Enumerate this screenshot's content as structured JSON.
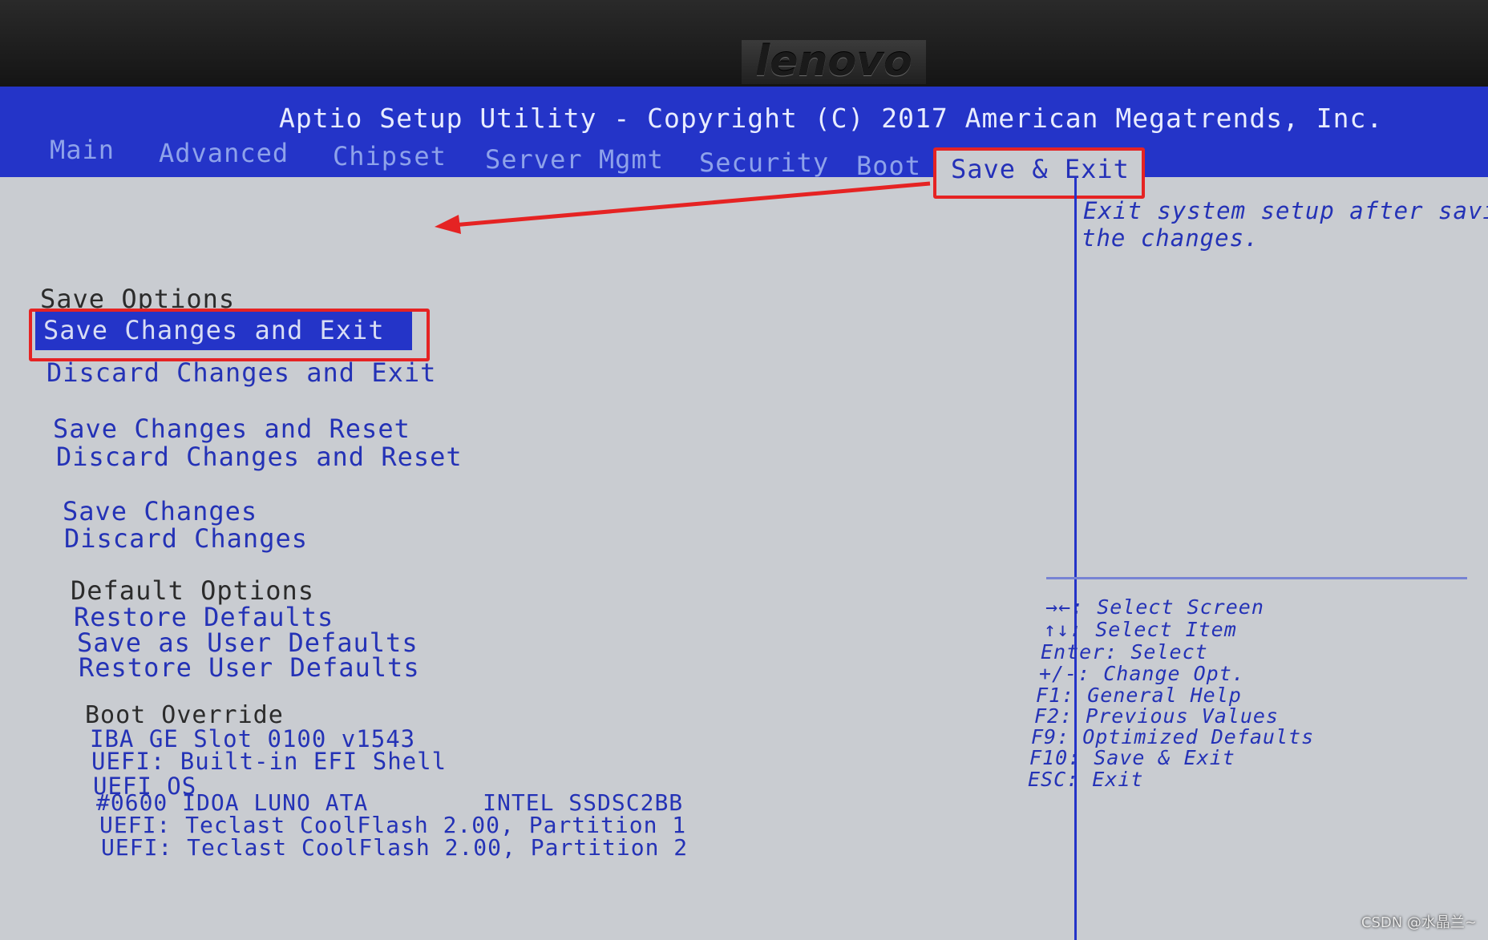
{
  "monitor": {
    "brand": "lenovo"
  },
  "title": "Aptio Setup Utility - Copyright (C) 2017 American Megatrends, Inc.",
  "tabs": [
    "Main",
    "Advanced",
    "Chipset",
    "Server Mgmt",
    "Security",
    "Boot",
    "Save & Exit"
  ],
  "active_tab": "Save & Exit",
  "menu": {
    "save_options_header": "Save Options",
    "save_changes_and_exit": "Save Changes and Exit",
    "discard_changes_and_exit": "Discard Changes and Exit",
    "save_changes_and_reset": "Save Changes and Reset",
    "discard_changes_and_reset": "Discard Changes and Reset",
    "save_changes": "Save Changes",
    "discard_changes": "Discard Changes",
    "default_options_header": "Default Options",
    "restore_defaults": "Restore Defaults",
    "save_as_user_defaults": "Save as User Defaults",
    "restore_user_defaults": "Restore User Defaults",
    "boot_override_header": "Boot Override",
    "boot_devices": [
      "IBA GE Slot 0100 v1543",
      "UEFI: Built-in EFI Shell",
      "UEFI OS",
      "#0600 IDOA LUNO ATA        INTEL SSDSC2BB",
      "UEFI: Teclast CoolFlash 2.00, Partition 1",
      "UEFI: Teclast CoolFlash 2.00, Partition 2"
    ]
  },
  "help": {
    "line1": "Exit system setup after savin",
    "line2": "the changes."
  },
  "keys": [
    "→←: Select Screen",
    "↑↓: Select Item",
    "Enter: Select",
    "+/-: Change Opt.",
    "F1: General Help",
    "F2: Previous Values",
    "F9: Optimized Defaults",
    "F10: Save & Exit",
    "ESC: Exit"
  ],
  "watermark": "CSDN @水晶兰~",
  "colors": {
    "bios_blue": "#2434c8",
    "screen_gray": "#c9ccd1",
    "annotation_red": "#e52323"
  }
}
